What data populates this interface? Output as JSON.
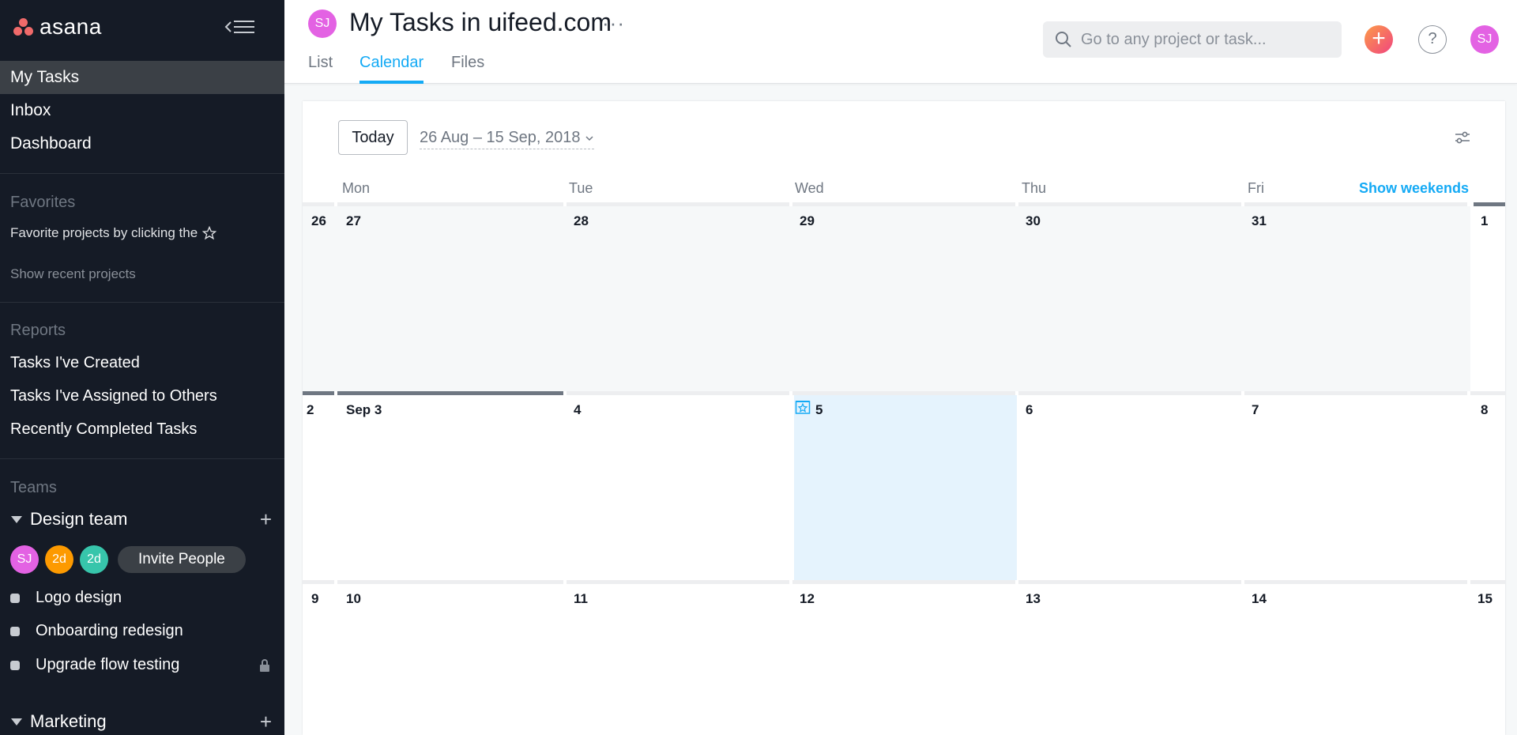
{
  "sidebar": {
    "logo": "asana",
    "nav": [
      "My Tasks",
      "Inbox",
      "Dashboard"
    ],
    "favorites_title": "Favorites",
    "favorites_hint": "Favorite projects by clicking the",
    "show_recent": "Show recent projects",
    "reports_title": "Reports",
    "reports": [
      "Tasks I've Created",
      "Tasks I've Assigned to Others",
      "Recently Completed Tasks"
    ],
    "teams_title": "Teams",
    "team1": {
      "name": "Design team",
      "members": [
        {
          "initials": "SJ",
          "color": "#e362e3"
        },
        {
          "initials": "2d",
          "color": "#fd9a00"
        },
        {
          "initials": "2d",
          "color": "#37c5ab"
        }
      ],
      "invite": "Invite People",
      "projects": [
        "Logo design",
        "Onboarding redesign",
        "Upgrade flow testing"
      ]
    },
    "team2": {
      "name": "Marketing"
    }
  },
  "header": {
    "avatar": "SJ",
    "title": "My Tasks in uifeed.com",
    "more": "···",
    "tabs": [
      "List",
      "Calendar",
      "Files"
    ],
    "active_tab": "Calendar",
    "search_placeholder": "Go to any project or task...",
    "add": "+",
    "help": "?",
    "user": "SJ"
  },
  "calendar": {
    "today_button": "Today",
    "range": "26 Aug – 15 Sep, 2018",
    "days_of_week": [
      "Mon",
      "Tue",
      "Wed",
      "Thu",
      "Fri"
    ],
    "show_weekends": "Show weekends",
    "weeks": [
      {
        "sun": "26",
        "days": [
          "27",
          "28",
          "29",
          "30",
          "31"
        ],
        "sat": "1"
      },
      {
        "sun": "2",
        "days": [
          "Sep 3",
          "4",
          "5",
          "6",
          "7"
        ],
        "sat": "8"
      },
      {
        "sun": "9",
        "days": [
          "10",
          "11",
          "12",
          "13",
          "14"
        ],
        "sat": "15"
      }
    ],
    "today": "5"
  },
  "colors": {
    "accent": "#14aaf5",
    "sidebar_bg": "#151b26",
    "today_bg": "#e5f3fd"
  }
}
